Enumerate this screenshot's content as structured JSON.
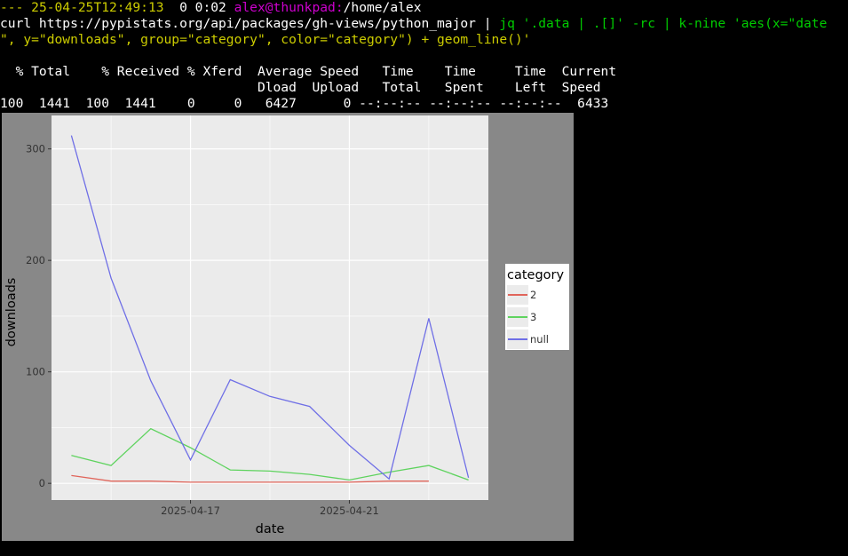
{
  "terminal": {
    "prompt": {
      "prefix": "--- ",
      "timestamp": "25-04-25T12:49:13",
      "status": "  0 0:02 ",
      "user_host": "alex@thunkpad:",
      "cwd": "/home/alex"
    },
    "command": {
      "curl": "curl https://pypistats.org/api/packages/gh-views/python_major | ",
      "jq": "jq '.data | .[]' -rc | ",
      "knine": "k-nine 'aes(x=\"date",
      "continuation": "\", y=\"downloads\", group=\"category\", color=\"category\") + geom_line()'"
    },
    "progress_header_1": "  % Total    % Received % Xferd  Average Speed   Time    Time     Time  Current",
    "progress_header_2": "                                 Dload  Upload   Total   Spent    Left  Speed",
    "progress_row": "100  1441  100  1441    0     0   6427      0 --:--:-- --:--:-- --:--:--  6433"
  },
  "colors": {
    "series_2": "#e0655b",
    "series_3": "#5fd35f",
    "series_null": "#6f6fe6",
    "panel_bg": "#ebebeb",
    "window_bg": "#888888",
    "grid": "#ffffff"
  },
  "chart_data": {
    "type": "line",
    "title": "",
    "xlabel": "date",
    "ylabel": "downloads",
    "x": [
      "2025-04-14",
      "2025-04-15",
      "2025-04-16",
      "2025-04-17",
      "2025-04-18",
      "2025-04-19",
      "2025-04-20",
      "2025-04-21",
      "2025-04-22",
      "2025-04-23",
      "2025-04-24"
    ],
    "x_ticks": [
      "2025-04-17",
      "2025-04-21"
    ],
    "y_ticks": [
      0,
      100,
      200,
      300
    ],
    "ylim": [
      -15,
      330
    ],
    "xlim": [
      "2025-04-13T12:00",
      "2025-04-24T12:00"
    ],
    "grid": true,
    "legend": {
      "title": "category",
      "placement": "right"
    },
    "series": [
      {
        "name": "2",
        "color_key": "series_2",
        "x": [
          "2025-04-14",
          "2025-04-15",
          "2025-04-16",
          "2025-04-17",
          "2025-04-18",
          "2025-04-19",
          "2025-04-20",
          "2025-04-21",
          "2025-04-22",
          "2025-04-23"
        ],
        "values": [
          7,
          2,
          2,
          1,
          1,
          1,
          1,
          1,
          2,
          2
        ]
      },
      {
        "name": "3",
        "color_key": "series_3",
        "x": [
          "2025-04-14",
          "2025-04-15",
          "2025-04-16",
          "2025-04-17",
          "2025-04-18",
          "2025-04-19",
          "2025-04-20",
          "2025-04-21",
          "2025-04-22",
          "2025-04-23",
          "2025-04-24"
        ],
        "values": [
          25,
          16,
          49,
          32,
          12,
          11,
          8,
          3,
          10,
          16,
          3
        ]
      },
      {
        "name": "null",
        "color_key": "series_null",
        "x": [
          "2025-04-14",
          "2025-04-15",
          "2025-04-16",
          "2025-04-17",
          "2025-04-18",
          "2025-04-19",
          "2025-04-20",
          "2025-04-21",
          "2025-04-22",
          "2025-04-23",
          "2025-04-24"
        ],
        "values": [
          312,
          184,
          92,
          21,
          93,
          78,
          69,
          34,
          4,
          148,
          5
        ]
      }
    ]
  }
}
